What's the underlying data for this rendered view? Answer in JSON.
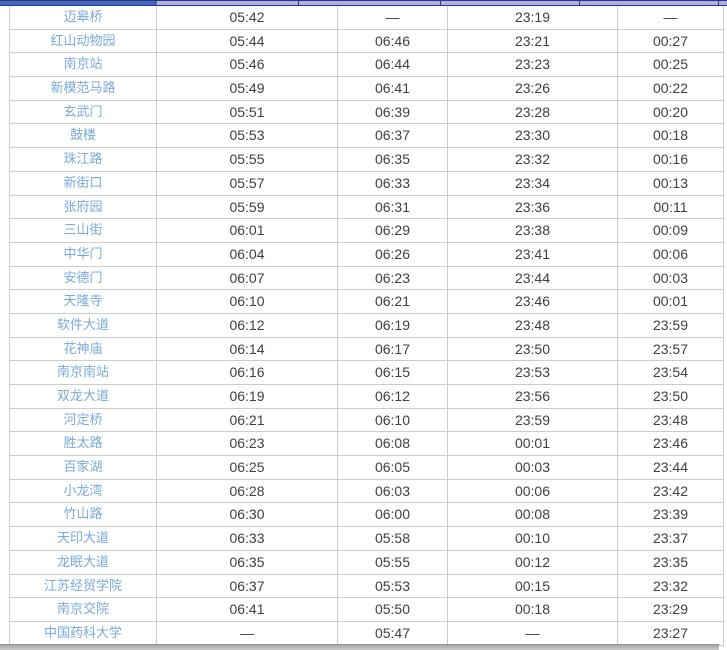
{
  "colors": {
    "link_blue": "#7ca9d4",
    "time_text": "#3f3f3f",
    "grid_border": "#cccccc",
    "strip_blue": "#4169b5",
    "strip_lavender": "#b0b0dc",
    "strip_navy": "#2e3191",
    "bottom_bar_grey": "#b5b2b2"
  },
  "timetable": {
    "rows": [
      {
        "station": "迈皋桥",
        "times": [
          "05:42",
          "—",
          "23:19",
          "—"
        ]
      },
      {
        "station": "红山动物园",
        "times": [
          "05:44",
          "06:46",
          "23:21",
          "00:27"
        ]
      },
      {
        "station": "南京站",
        "times": [
          "05:46",
          "06:44",
          "23:23",
          "00:25"
        ]
      },
      {
        "station": "新模范马路",
        "times": [
          "05:49",
          "06:41",
          "23:26",
          "00:22"
        ]
      },
      {
        "station": "玄武门",
        "times": [
          "05:51",
          "06:39",
          "23:28",
          "00:20"
        ]
      },
      {
        "station": "鼓楼",
        "times": [
          "05:53",
          "06:37",
          "23:30",
          "00:18"
        ]
      },
      {
        "station": "珠江路",
        "times": [
          "05:55",
          "06:35",
          "23:32",
          "00:16"
        ]
      },
      {
        "station": "新街口",
        "times": [
          "05:57",
          "06:33",
          "23:34",
          "00:13"
        ]
      },
      {
        "station": "张府园",
        "times": [
          "05:59",
          "06:31",
          "23:36",
          "00:11"
        ]
      },
      {
        "station": "三山街",
        "times": [
          "06:01",
          "06:29",
          "23:38",
          "00:09"
        ]
      },
      {
        "station": "中华门",
        "times": [
          "06:04",
          "06:26",
          "23:41",
          "00:06"
        ]
      },
      {
        "station": "安德门",
        "times": [
          "06:07",
          "06:23",
          "23:44",
          "00:03"
        ]
      },
      {
        "station": "天隆寺",
        "times": [
          "06:10",
          "06:21",
          "23:46",
          "00:01"
        ]
      },
      {
        "station": "软件大道",
        "times": [
          "06:12",
          "06:19",
          "23:48",
          "23:59"
        ]
      },
      {
        "station": "花神庙",
        "times": [
          "06:14",
          "06:17",
          "23:50",
          "23:57"
        ]
      },
      {
        "station": "南京南站",
        "times": [
          "06:16",
          "06:15",
          "23:53",
          "23:54"
        ]
      },
      {
        "station": "双龙大道",
        "times": [
          "06:19",
          "06:12",
          "23:56",
          "23:50"
        ]
      },
      {
        "station": "河定桥",
        "times": [
          "06:21",
          "06:10",
          "23:59",
          "23:48"
        ]
      },
      {
        "station": "胜太路",
        "times": [
          "06:23",
          "06:08",
          "00:01",
          "23:46"
        ]
      },
      {
        "station": "百家湖",
        "times": [
          "06:25",
          "06:05",
          "00:03",
          "23:44"
        ]
      },
      {
        "station": "小龙湾",
        "times": [
          "06:28",
          "06:03",
          "00:06",
          "23:42"
        ]
      },
      {
        "station": "竹山路",
        "times": [
          "06:30",
          "06:00",
          "00:08",
          "23:39"
        ]
      },
      {
        "station": "天印大道",
        "times": [
          "06:33",
          "05:58",
          "00:10",
          "23:37"
        ]
      },
      {
        "station": "龙眠大道",
        "times": [
          "06:35",
          "05:55",
          "00:12",
          "23:35"
        ]
      },
      {
        "station": "江苏经贸学院",
        "times": [
          "06:37",
          "05:53",
          "00:15",
          "23:32"
        ]
      },
      {
        "station": "南京交院",
        "times": [
          "06:41",
          "05:50",
          "00:18",
          "23:29"
        ]
      },
      {
        "station": "中国药科大学",
        "times": [
          "—",
          "05:47",
          "—",
          "23:27"
        ]
      }
    ]
  }
}
